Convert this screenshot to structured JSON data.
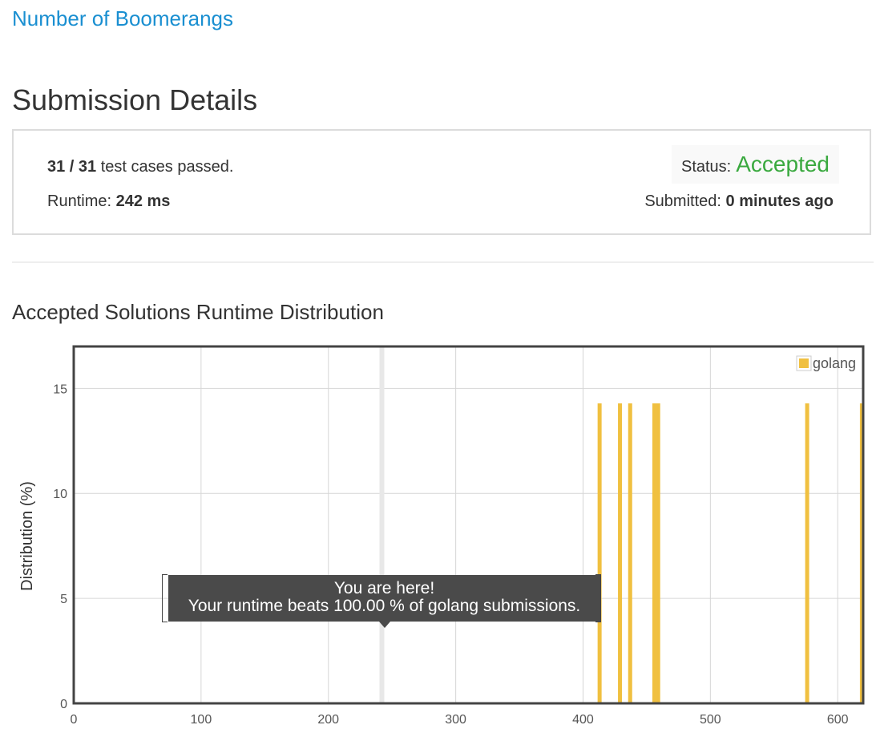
{
  "problem": {
    "title": "Number of Boomerangs"
  },
  "submission": {
    "heading": "Submission Details",
    "tests_passed": "31 / 31",
    "tests_suffix": " test cases passed.",
    "runtime_label": "Runtime: ",
    "runtime_value": "242 ms",
    "status_label": "Status:",
    "status_value": "Accepted",
    "submitted_label": "Submitted: ",
    "submitted_value": "0 minutes ago",
    "colors": {
      "accepted": "#3aa93f",
      "link": "#1a8fd1"
    }
  },
  "distribution": {
    "heading": "Accepted Solutions Runtime Distribution"
  },
  "tooltip": {
    "line1": "You are here!",
    "line2": "Your runtime beats 100.00 % of golang submissions."
  },
  "chart_data": {
    "type": "bar",
    "ylabel": "Distribution (%)",
    "xlabel": "",
    "xlim": [
      0,
      620
    ],
    "ylim": [
      0,
      17
    ],
    "xticks": [
      0,
      100,
      200,
      300,
      400,
      500,
      600
    ],
    "yticks": [
      0,
      5,
      10,
      15
    ],
    "grid": true,
    "legend_position": "top-right",
    "series": [
      {
        "name": "golang",
        "color": "#f0c040",
        "x": [
          413,
          429,
          437,
          456,
          459,
          576,
          619
        ],
        "values": [
          14.29,
          14.29,
          14.29,
          14.29,
          14.29,
          14.29,
          14.29
        ]
      }
    ],
    "marker": {
      "x": 242,
      "color": "#e8e8e8"
    }
  }
}
